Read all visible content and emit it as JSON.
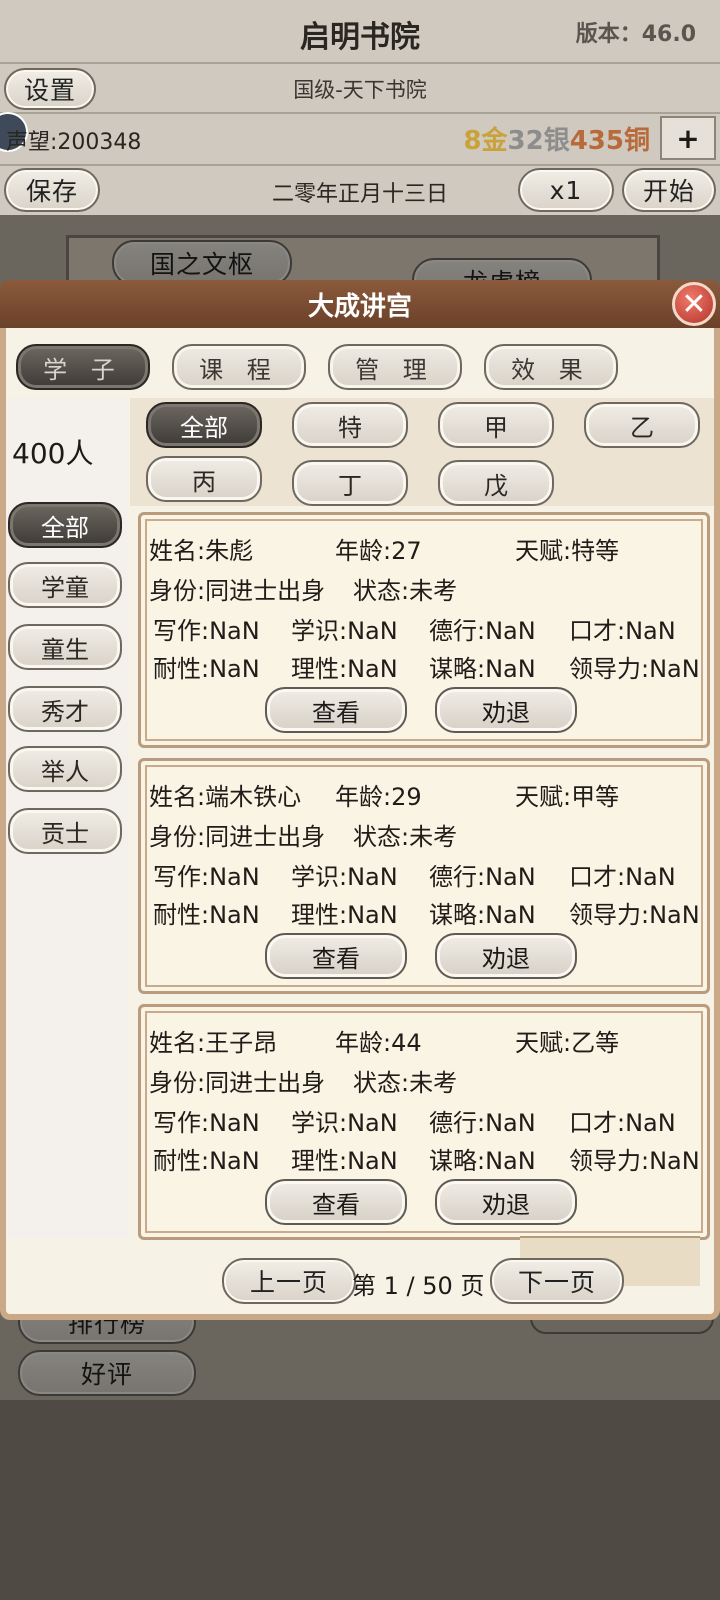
{
  "header": {
    "title": "启明书院",
    "version": "版本：46.0",
    "settings": "设置",
    "rank": "国级-天下书院",
    "prestige": "声望:200348",
    "gold": "8金",
    "silver": "32银",
    "copper": "435铜",
    "add": "+",
    "save": "保存",
    "date": "二零年正月十三日",
    "speed": "x1",
    "start": "开始"
  },
  "background": {
    "building_left": "国之文枢",
    "building_right": "龙虎榜",
    "rank_board": "排行榜",
    "review": "好评"
  },
  "modal": {
    "title": "大成讲宫",
    "close": "✕",
    "tabs": [
      "学 子",
      "课 程",
      "管 理",
      "效 果"
    ],
    "count": "400人",
    "tiers": [
      "全部",
      "特",
      "甲",
      "乙",
      "丙",
      "丁",
      "戊"
    ],
    "categories": [
      "全部",
      "学童",
      "童生",
      "秀才",
      "举人",
      "贡士"
    ],
    "students": [
      {
        "name": "姓名:朱彪",
        "age": "年龄:27",
        "talent": "天赋:特等",
        "identity": "身份:同进士出身",
        "status": "状态:未考",
        "writing": "写作:NaN",
        "knowledge": "学识:NaN",
        "virtue": "德行:NaN",
        "eloquence": "口才:NaN",
        "patience": "耐性:NaN",
        "reason": "理性:NaN",
        "strategy": "谋略:NaN",
        "leadership": "领导力:NaN",
        "view": "查看",
        "dismiss": "劝退"
      },
      {
        "name": "姓名:端木铁心",
        "age": "年龄:29",
        "talent": "天赋:甲等",
        "identity": "身份:同进士出身",
        "status": "状态:未考",
        "writing": "写作:NaN",
        "knowledge": "学识:NaN",
        "virtue": "德行:NaN",
        "eloquence": "口才:NaN",
        "patience": "耐性:NaN",
        "reason": "理性:NaN",
        "strategy": "谋略:NaN",
        "leadership": "领导力:NaN",
        "view": "查看",
        "dismiss": "劝退"
      },
      {
        "name": "姓名:王子昂",
        "age": "年龄:44",
        "talent": "天赋:乙等",
        "identity": "身份:同进士出身",
        "status": "状态:未考",
        "writing": "写作:NaN",
        "knowledge": "学识:NaN",
        "virtue": "德行:NaN",
        "eloquence": "口才:NaN",
        "patience": "耐性:NaN",
        "reason": "理性:NaN",
        "strategy": "谋略:NaN",
        "leadership": "领导力:NaN",
        "view": "查看",
        "dismiss": "劝退"
      }
    ],
    "pagination": {
      "prev": "上一页",
      "page": "第 1 / 50 页",
      "next": "下一页"
    }
  },
  "colors": {
    "gold": "#c9a23a",
    "silver": "#8d8d8d",
    "copper": "#b86a3a",
    "title_bar": "#7a4a30"
  }
}
